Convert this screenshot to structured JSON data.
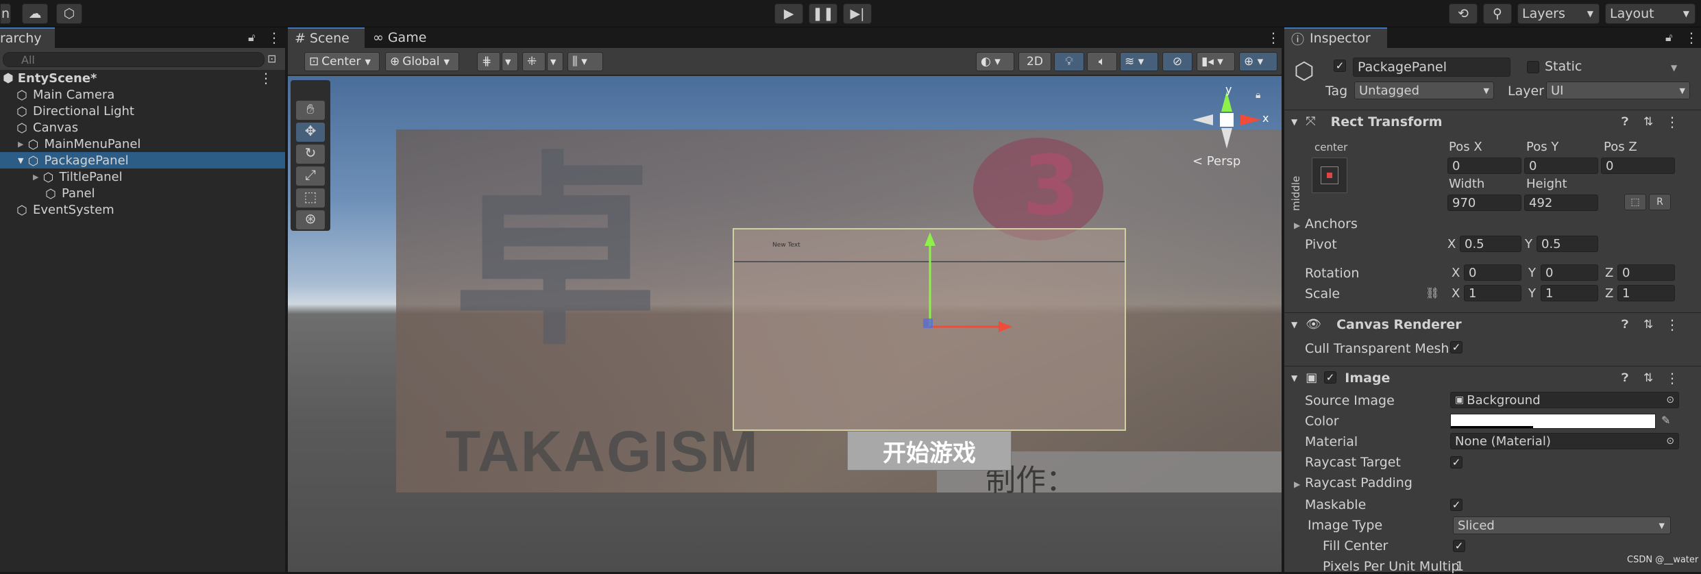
{
  "topbar": {
    "left_cut": "n",
    "layers": "Layers",
    "layout": "Layout"
  },
  "hierarchy": {
    "tab": "rarchy",
    "search_placeholder": "All",
    "scene": "EntyScene*",
    "items": [
      {
        "label": "Main Camera"
      },
      {
        "label": "Directional Light"
      },
      {
        "label": "Canvas"
      },
      {
        "label": "MainMenuPanel"
      },
      {
        "label": "PackagePanel"
      },
      {
        "label": "TiltlePanel"
      },
      {
        "label": "Panel"
      },
      {
        "label": "EventSystem"
      }
    ]
  },
  "scene": {
    "tab_scene": "Scene",
    "tab_game": "Game",
    "pivot": "Center",
    "space": "Global",
    "btn_2d": "2D",
    "persp": "< Persp",
    "gizmo_y": "y",
    "gizmo_x": "x",
    "new_text": "New Text",
    "start_button": "开始游戏",
    "made_by": "制作：",
    "bg_text": "TAKAGISM",
    "watermark": "CSDN @__water"
  },
  "inspector": {
    "tab": "Inspector",
    "object_name": "PackagePanel",
    "static": "Static",
    "tag_label": "Tag",
    "tag_value": "Untagged",
    "layer_label": "Layer",
    "layer_value": "UI",
    "rect_transform": {
      "title": "Rect Transform",
      "anchor_h": "center",
      "anchor_v": "middle",
      "pos_x_label": "Pos X",
      "pos_x": "0",
      "pos_y_label": "Pos Y",
      "pos_y": "0",
      "pos_z_label": "Pos Z",
      "pos_z": "0",
      "width_label": "Width",
      "width": "970",
      "height_label": "Height",
      "height": "492",
      "anchors": "Anchors",
      "pivot_label": "Pivot",
      "pivot_x": "0.5",
      "pivot_y": "0.5",
      "rotation_label": "Rotation",
      "rot_x": "0",
      "rot_y": "0",
      "rot_z": "0",
      "scale_label": "Scale",
      "scale_x": "1",
      "scale_y": "1",
      "scale_z": "1",
      "x": "X",
      "y": "Y",
      "z": "Z"
    },
    "canvas_renderer": {
      "title": "Canvas Renderer",
      "cull": "Cull Transparent Mesh"
    },
    "image": {
      "title": "Image",
      "source_label": "Source Image",
      "source_value": "Background",
      "color_label": "Color",
      "material_label": "Material",
      "material_value": "None (Material)",
      "raycast_target": "Raycast Target",
      "raycast_padding": "Raycast Padding",
      "maskable": "Maskable",
      "image_type_label": "Image Type",
      "image_type_value": "Sliced",
      "fill_center": "Fill Center",
      "ppu_label": "Pixels Per Unit Multip",
      "ppu_value": "1"
    }
  }
}
